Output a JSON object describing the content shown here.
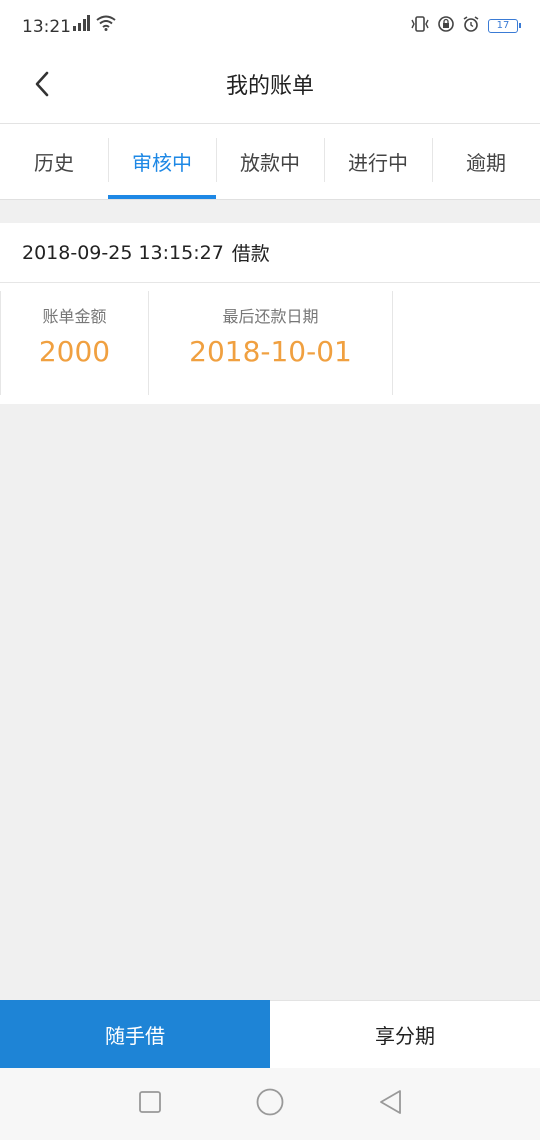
{
  "status_bar": {
    "time": "13:21",
    "battery": "17",
    "icons": [
      "signal-icon",
      "wifi-icon",
      "vibrate-icon",
      "lock-icon",
      "alarm-icon",
      "battery-icon"
    ]
  },
  "header": {
    "title": "我的账单",
    "back_icon": "chevron-left-icon"
  },
  "tabs": [
    {
      "label": "历史",
      "active": false
    },
    {
      "label": "审核中",
      "active": true
    },
    {
      "label": "放款中",
      "active": false
    },
    {
      "label": "进行中",
      "active": false
    },
    {
      "label": "逾期",
      "active": false
    }
  ],
  "bill": {
    "datetime": "2018-09-25 13:15:27",
    "type": "借款",
    "amount_label": "账单金额",
    "amount_value": "2000",
    "due_label": "最后还款日期",
    "due_value": "2018-10-01"
  },
  "bottom": {
    "borrow_label": "随手借",
    "installment_label": "享分期"
  },
  "colors": {
    "accent": "#1e88e5",
    "value": "#f0a040",
    "background": "#f0f0f0"
  }
}
